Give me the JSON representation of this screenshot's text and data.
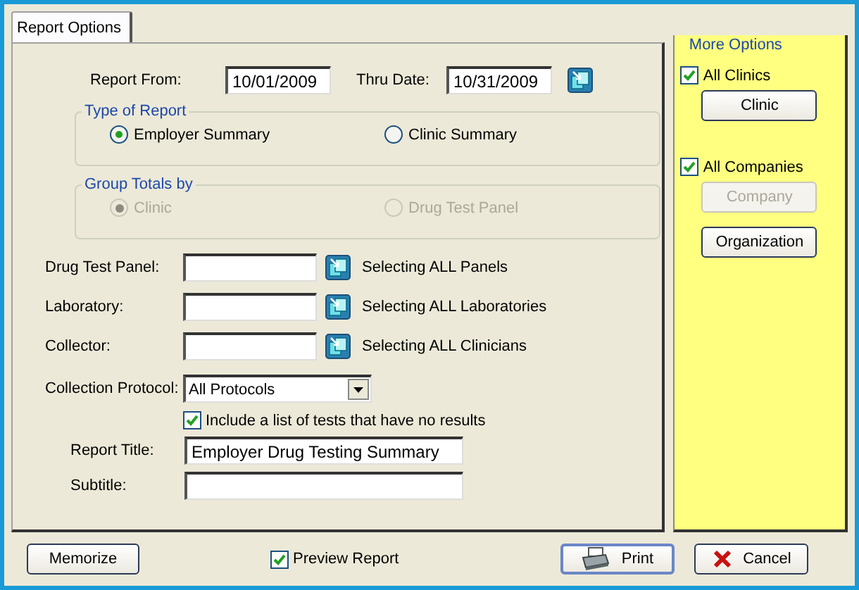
{
  "tabs": [
    {
      "label": "Report Options",
      "selected": true
    }
  ],
  "date_range": {
    "from_label": "Report From:",
    "from_value": "10/01/2009",
    "thru_label": "Thru Date:",
    "thru_value": "10/31/2009"
  },
  "groups": [
    {
      "title": "Type of Report",
      "disabled": false,
      "options": [
        {
          "label": "Employer Summary",
          "selected": true
        },
        {
          "label": "Clinic Summary",
          "selected": false
        }
      ]
    },
    {
      "title": "Group Totals by",
      "disabled": true,
      "options": [
        {
          "label": "Clinic",
          "selected": true
        },
        {
          "label": "Drug Test Panel",
          "selected": false
        }
      ]
    }
  ],
  "lookups": [
    {
      "label": "Drug Test Panel:",
      "status": "Selecting ALL Panels"
    },
    {
      "label": "Laboratory:",
      "status": "Selecting ALL Laboratories"
    },
    {
      "label": "Collector:",
      "status": "Selecting ALL Clinicians"
    }
  ],
  "protocol": {
    "label": "Collection Protocol:",
    "value": "All Protocols"
  },
  "include_no_results": {
    "label": "Include a list of tests that have no results",
    "checked": true
  },
  "titles": [
    {
      "label": "Report Title:",
      "value": "Employer Drug Testing Summary"
    },
    {
      "label": "Subtitle:"
    }
  ],
  "more_options": {
    "title": "More Options",
    "items": [
      {
        "kind": "checkbox",
        "label": "All Clinics",
        "checked": true
      },
      {
        "kind": "button",
        "label": "Clinic",
        "disabled": false
      },
      {
        "kind": "checkbox",
        "label": "All Companies",
        "checked": true
      },
      {
        "kind": "button",
        "label": "Company",
        "disabled": true
      },
      {
        "kind": "button",
        "label": "Organization",
        "disabled": false
      }
    ]
  },
  "footer": {
    "memorize": "Memorize",
    "preview": {
      "label": "Preview Report",
      "checked": true
    },
    "buttons": [
      {
        "kind": "print",
        "label": "Print"
      },
      {
        "kind": "cancel",
        "label": "Cancel"
      }
    ]
  }
}
